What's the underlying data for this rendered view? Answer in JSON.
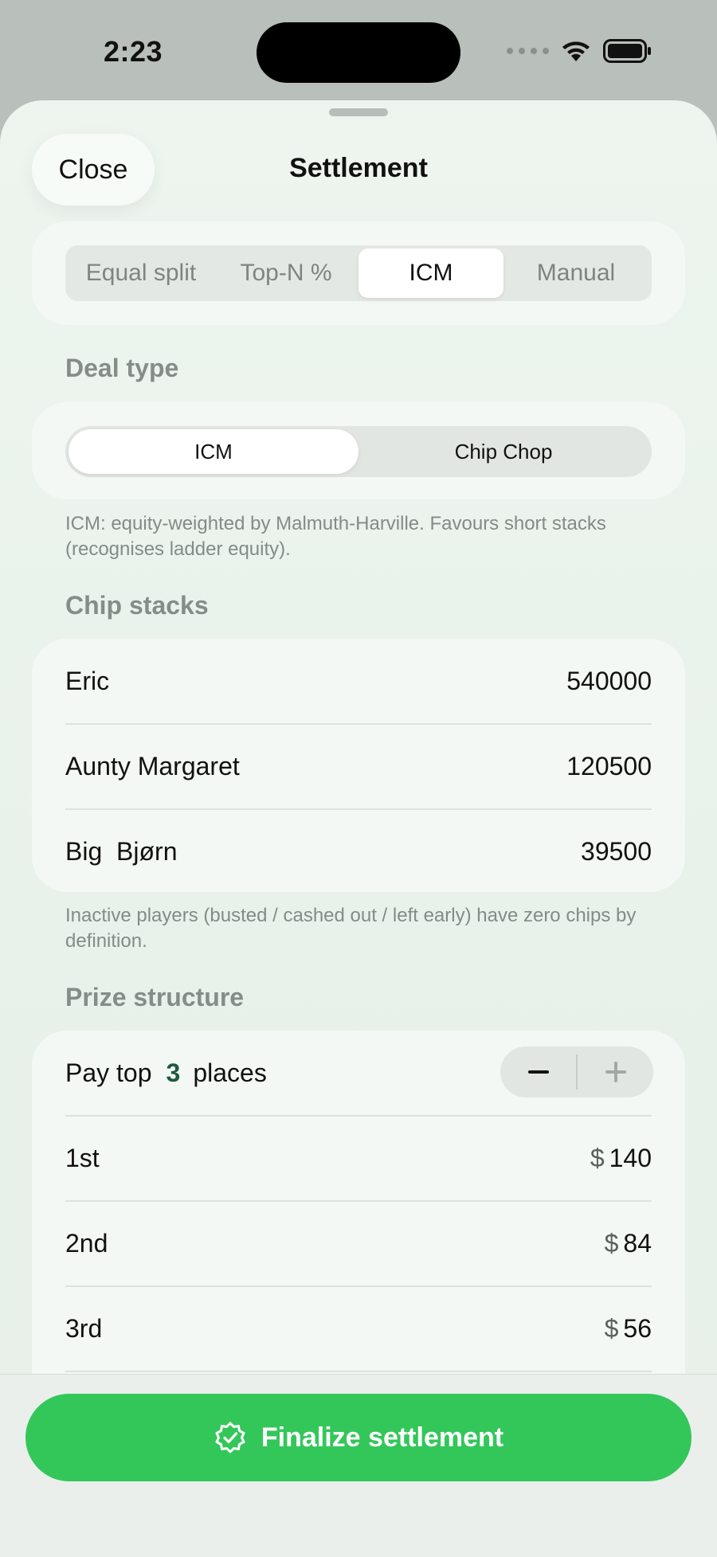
{
  "status": {
    "time": "2:23"
  },
  "sheet": {
    "title": "Settlement",
    "close_label": "Close"
  },
  "method_tabs": [
    "Equal split",
    "Top-N %",
    "ICM",
    "Manual"
  ],
  "method_selected": "ICM",
  "deal_type": {
    "label": "Deal type",
    "options": [
      "ICM",
      "Chip Chop"
    ],
    "selected": "ICM",
    "note": "ICM: equity-weighted by Malmuth-Harville. Favours short stacks (recognises ladder equity)."
  },
  "chip_stacks": {
    "label": "Chip stacks",
    "players": [
      {
        "name": "Eric",
        "chips": "540000"
      },
      {
        "name": "Aunty Margaret",
        "chips": "120500"
      },
      {
        "name": "Big  Bjørn",
        "chips": "39500"
      }
    ],
    "note": "Inactive players (busted / cashed out / left early) have zero chips by definition."
  },
  "prize_structure": {
    "label": "Prize structure",
    "pay_prefix": "Pay top",
    "pay_count": "3",
    "pay_suffix": "places",
    "currency": "$",
    "places": [
      {
        "place": "1st",
        "amount": "140"
      },
      {
        "place": "2nd",
        "amount": "84"
      },
      {
        "place": "3rd",
        "amount": "56"
      }
    ]
  },
  "finalize_label": "Finalize settlement",
  "colors": {
    "accent_green": "#33c75a",
    "count_green": "#1e5a3c"
  }
}
